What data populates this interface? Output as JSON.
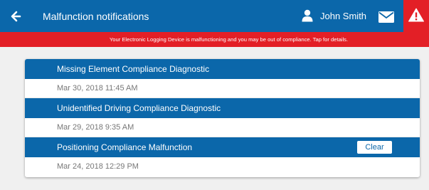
{
  "header": {
    "title": "Malfunction notifications",
    "user_name": "John Smith",
    "back_icon": "arrow-left-icon",
    "user_icon": "user-icon",
    "mail_icon": "envelope-icon",
    "alert_icon": "warning-icon"
  },
  "banner": {
    "text": "Your Electronic Logging Device is malfunctioning and you may be out of compliance. Tap for details."
  },
  "notifications": [
    {
      "title": "Missing Element Compliance Diagnostic",
      "date": "Mar 30, 2018 11:45 AM"
    },
    {
      "title": "Unidentified Driving Compliance Diagnostic",
      "date": "Mar 29, 2018 9:35 AM"
    },
    {
      "title": "Positioning Compliance Malfunction",
      "date": "Mar 24, 2018 12:29 PM",
      "action_label": "Clear"
    }
  ],
  "colors": {
    "header_blue": "#0b67aa",
    "alert_red": "#e31f26",
    "background": "#f0f0f0",
    "date_text": "#777777"
  }
}
